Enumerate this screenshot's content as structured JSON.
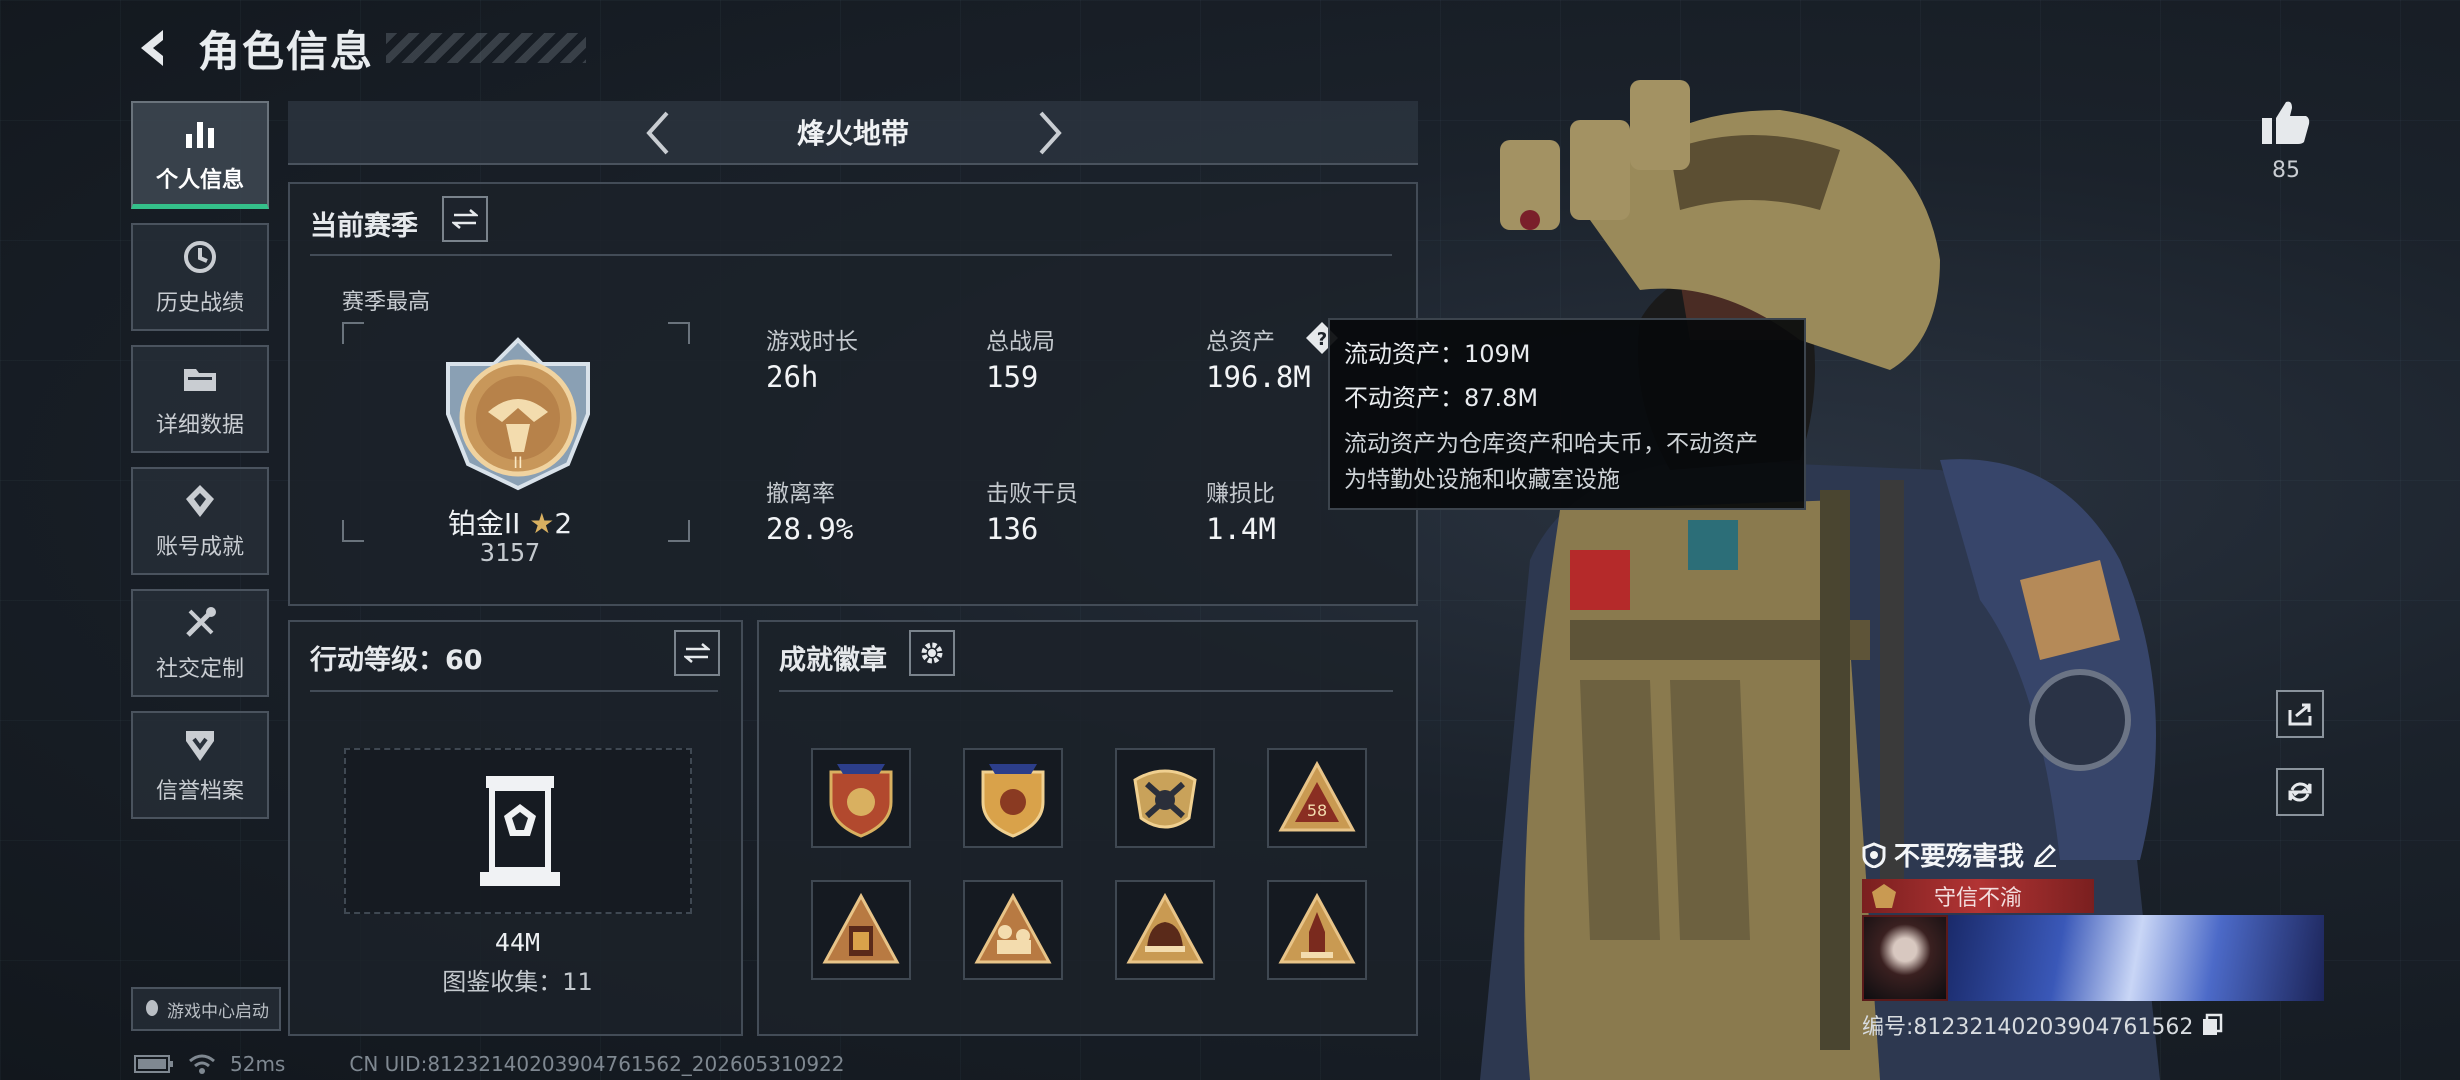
{
  "header": {
    "title": "角色信息"
  },
  "sidebar": {
    "items": [
      {
        "label": "个人信息",
        "icon": "bar-chart-icon",
        "active": true
      },
      {
        "label": "历史战绩",
        "icon": "history-icon"
      },
      {
        "label": "详细数据",
        "icon": "folder-icon"
      },
      {
        "label": "账号成就",
        "icon": "achievement-icon"
      },
      {
        "label": "社交定制",
        "icon": "tools-icon"
      },
      {
        "label": "信誉档案",
        "icon": "credit-icon"
      }
    ],
    "game_center_label": "游戏中心启动"
  },
  "mode": {
    "title": "烽火地带"
  },
  "season": {
    "title": "当前赛季",
    "best_label": "赛季最高",
    "rank_name": "铂金II",
    "rank_stars": "2",
    "rank_score": "3157",
    "stats": [
      {
        "label": "游戏时长",
        "value": "26h"
      },
      {
        "label": "总战局",
        "value": "159"
      },
      {
        "label": "总资产",
        "value": "196.8M"
      },
      {
        "label": "撤离率",
        "value": "28.9%"
      },
      {
        "label": "击败干员",
        "value": "136"
      },
      {
        "label": "赚损比",
        "value": "1.4M"
      }
    ]
  },
  "tooltip": {
    "liquid": "流动资产：109M",
    "fixed": "不动资产：87.8M",
    "desc_line1": "流动资产为仓库资产和哈夫币，不动资产",
    "desc_line2": "为特勤处设施和收藏室设施"
  },
  "action_level": {
    "title": "行动等级：60",
    "value": "44M",
    "collection": "图鉴收集：11"
  },
  "badges": {
    "title": "成就徽章",
    "badge_58_text": "58",
    "items": [
      "shield-stars-badge-icon",
      "gold-shield-stars-badge-icon",
      "crossed-emblem-badge-icon",
      "triangle-58-badge-icon",
      "triangle-door-badge-icon",
      "triangle-figures-badge-icon",
      "triangle-helmet-badge-icon",
      "triangle-rocket-badge-icon"
    ]
  },
  "right": {
    "like_count": "85"
  },
  "player": {
    "name": "不要殇害我",
    "title": "守信不渝",
    "uid_label": "编号:81232140203904761562"
  },
  "status": {
    "ping": "52ms",
    "uid_footer": "CN UID:81232140203904761562_202605310922"
  },
  "colors": {
    "accent": "#34c08a",
    "title_red": "#b23434",
    "gold": "#c9a25a"
  }
}
